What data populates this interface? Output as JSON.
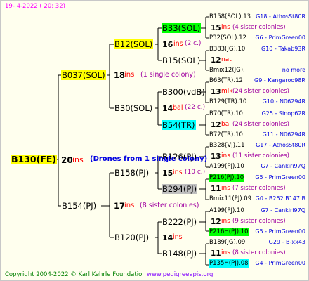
{
  "header_date": "19-  4-2022 ( 20: 32)",
  "footer": {
    "copyright": "Copyright 2004-2022 © Karl Kehrle Foundation",
    "site": "www.pedigreeapis.org"
  },
  "root": {
    "name": "B130(FE)",
    "num": "20",
    "ins": "ins",
    "note": "(Drones from 1 single colony)"
  },
  "mother": {
    "name": "B037(SOL)",
    "num": "18",
    "ins": "ins",
    "note": "(1 single colony)"
  },
  "father": {
    "name": "B154(PJ)",
    "num": "17",
    "ins": "ins",
    "note": "(8 sister colonies)"
  },
  "g3": [
    {
      "name": "B12(SOL)",
      "num": "16",
      "ins": "ins",
      "note": "(2 c.)"
    },
    {
      "name": "B30(SOL)",
      "num": "14",
      "ins": "bal",
      "note": "(22 c.)"
    },
    {
      "name": "B158(PJ)",
      "num": "15",
      "ins": "ins",
      "note": "(10 c.)"
    },
    {
      "name": "B120(PJ)",
      "num": "14",
      "ins": "ins",
      "note": ""
    }
  ],
  "g4": [
    {
      "name": "B33(SOL)",
      "num": "15",
      "ins": "ins",
      "note": "(4 sister colonies)",
      "top": "B158(SOL).13",
      "top_line": "G18 - AthosSt80R",
      "bot": "P32(SOL).12",
      "bot_line": "G6 - PrimGreen00"
    },
    {
      "name": "B15(SOL)",
      "num": "12",
      "ins": "nat",
      "note": "",
      "top": "B383(JG).10",
      "top_line": "G10 - Takab93R",
      "bot": "Bmix12(JG).",
      "bot_line": "no more"
    },
    {
      "name": "B300(vdB)",
      "num": "13",
      "ins": "mik",
      "note": "(24 sister colonies)",
      "top": "B63(TR).12",
      "top_line": "G9 - Kangaroo98R",
      "bot": "B129(TR).10",
      "bot_line": "G10 - N06294R"
    },
    {
      "name": "B54(TR)",
      "num": "12",
      "ins": "bal",
      "note": "(24 sister colonies)",
      "top": "B70(TR).10",
      "top_line": "G25 - Sinop62R",
      "bot": "B72(TR).10",
      "bot_line": "G11 - N06294R"
    },
    {
      "name": "B126(PJ)",
      "num": "13",
      "ins": "ins",
      "note": "(11 sister colonies)",
      "top": "B328(VJ).11",
      "top_line": "G17 - AthosSt80R",
      "bot": "A199(PJ).10",
      "bot_line": "G7 - Cankiri97Q"
    },
    {
      "name": "B294(PJ)",
      "num": "11",
      "ins": "ins",
      "note": "(7 sister colonies)",
      "top": "P216(PJ).10",
      "top_line": "G5 - PrimGreen00",
      "bot": "Bmix11(PJ).09",
      "bot_line": "G0 - B252 B147 B"
    },
    {
      "name": "B222(PJ)",
      "num": "12",
      "ins": "ins",
      "note": "(9 sister colonies)",
      "top": "A199(PJ).10",
      "top_line": "G7 - Cankiri97Q",
      "bot": "P216H(PJ).10",
      "bot_line": "G5 - PrimGreen00"
    },
    {
      "name": "B148(PJ)",
      "num": "11",
      "ins": "ins",
      "note": "(8 sister colonies)",
      "top": "B189(JG).09",
      "top_line": "G29 - B-xx43",
      "bot": "P135H(PJ).08",
      "bot_line": "G4 - PrimGreen00"
    }
  ],
  "colors": {
    "yellow": "#ffff00",
    "green": "#00ff00",
    "cyan": "#00ffff",
    "gray": "#c0c0c0",
    "red": "#ff0000",
    "purple": "#a000a0",
    "blue": "#0000e0",
    "header": "#ff00ff",
    "footer": "#008000",
    "site": "#8000ff"
  }
}
